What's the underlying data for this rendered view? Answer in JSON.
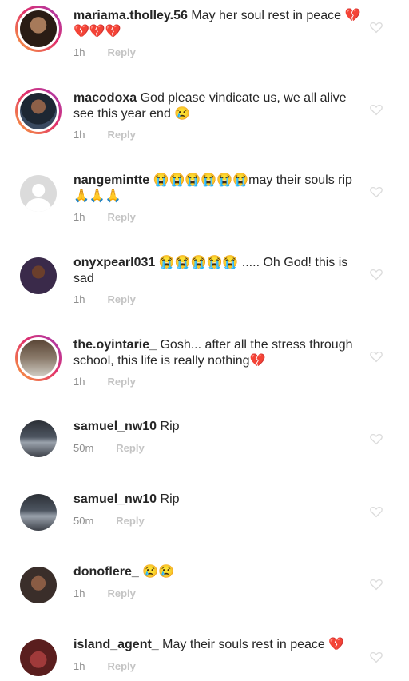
{
  "comments": [
    {
      "username": "mariama.tholley.56",
      "text": "May her soul rest in peace 💔💔💔💔",
      "time": "1h",
      "reply": "Reply"
    },
    {
      "username": "macodoxa",
      "text": "God please vindicate us, we all alive see this year end 😢",
      "time": "1h",
      "reply": "Reply"
    },
    {
      "username": "nangemintte",
      "text": "😭😭😭😭😭😭may their souls rip🙏🙏🙏",
      "time": "1h",
      "reply": "Reply"
    },
    {
      "username": "onyxpearl031",
      "text": "😭😭😭😭😭 ..... Oh God! this is sad",
      "time": "1h",
      "reply": "Reply"
    },
    {
      "username": "the.oyintarie_",
      "text": "Gosh... after all the stress through school, this life is really nothing💔",
      "time": "1h",
      "reply": "Reply"
    },
    {
      "username": "samuel_nw10",
      "text": "Rip",
      "time": "50m",
      "reply": "Reply"
    },
    {
      "username": "samuel_nw10",
      "text": "Rip",
      "time": "50m",
      "reply": "Reply"
    },
    {
      "username": "donoflere_",
      "text": "😢😢",
      "time": "1h",
      "reply": "Reply"
    },
    {
      "username": "island_agent_",
      "text": "May their souls rest in peace 💔",
      "time": "1h",
      "reply": "Reply"
    }
  ],
  "colors": {
    "username": "#262626",
    "meta": "#8e8e8e",
    "reply": "#c4c4c4",
    "heart": "#dcdcdc"
  },
  "icons": {
    "like": "heart-outline-icon",
    "avatar_default": "default-avatar-icon"
  }
}
